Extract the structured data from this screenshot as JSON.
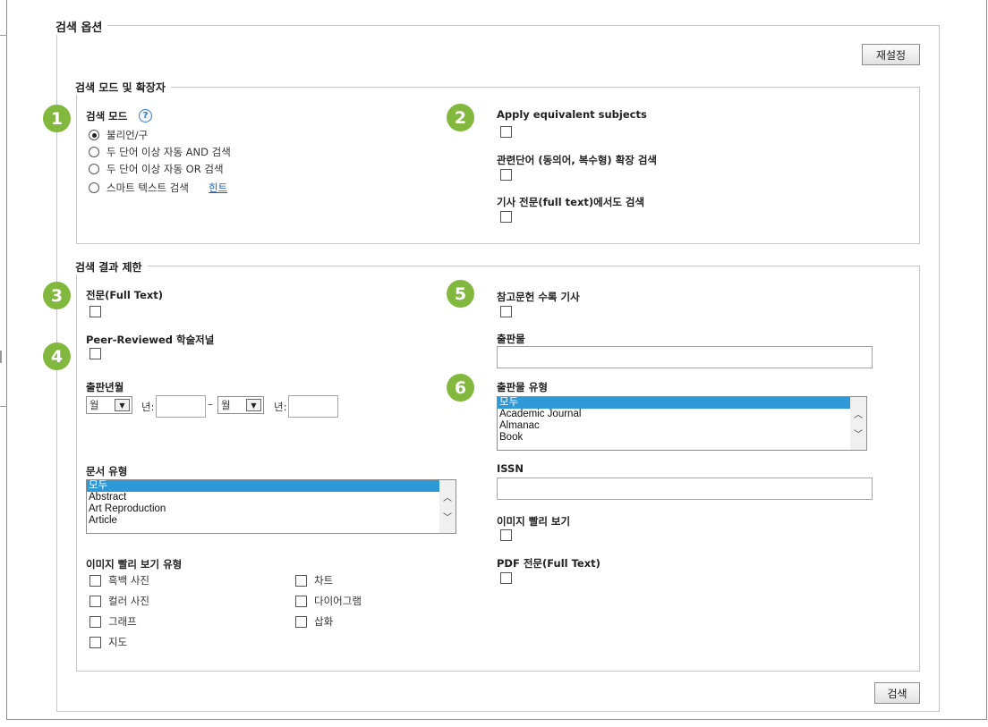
{
  "search_options": {
    "title": "검색 옵션",
    "reset_label": "재설정",
    "search_label": "검색"
  },
  "badges": [
    "1",
    "2",
    "3",
    "4",
    "5",
    "6"
  ],
  "mode_section": {
    "title": "검색 모드 및 확장자",
    "mode_label": "검색 모드",
    "help_icon": "?",
    "radio_options": [
      "불리언/구",
      "두 단어 이상 자동 AND 검색",
      "두 단어 이상 자동 OR 검색",
      "스마트 텍스트 검색"
    ],
    "selected_option": "불리언/구",
    "hint_link": "힌트",
    "expanders": [
      "Apply equivalent subjects",
      "관련단어 (동의어, 복수형) 확장 검색",
      "기사 전문(full text)에서도 검색"
    ]
  },
  "limits_section": {
    "title": "검색 결과 제한",
    "full_text_label": "전문(Full Text)",
    "peer_reviewed_label": "Peer-Reviewed 학술저널",
    "pub_date": {
      "label": "출판년월",
      "month_placeholder": "월",
      "year_label": "년:",
      "dash": "–"
    },
    "doc_type": {
      "label": "문서 유형",
      "items": [
        "모두",
        "Abstract",
        "Art Reproduction",
        "Article"
      ],
      "selected": "모두"
    },
    "image_type": {
      "label": "이미지 빨리 보기 유형",
      "col1": [
        "흑백 사진",
        "컬러 사진",
        "그래프",
        "지도"
      ],
      "col2": [
        "차트",
        "다이어그램",
        "삽화"
      ]
    },
    "references_label": "참고문헌 수록 기사",
    "publication_label": "출판물",
    "pub_type": {
      "label": "출판물 유형",
      "items": [
        "모두",
        "Academic Journal",
        "Almanac",
        "Book"
      ],
      "selected": "모두"
    },
    "issn_label": "ISSN",
    "image_quick_view_label": "이미지 빨리 보기",
    "pdf_full_text_label": "PDF 전문(Full Text)"
  },
  "colors": {
    "badge": "#82b83e",
    "selection": "#2f98d6",
    "link": "#1b5fb3"
  }
}
